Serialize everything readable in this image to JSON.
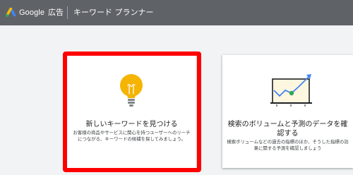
{
  "header": {
    "brand_google": "Google",
    "brand_ads": "広告",
    "tool_title": "キーワード プランナー"
  },
  "cards": [
    {
      "title": "新しいキーワードを見つける",
      "description": "お客様の商品やサービスに関心を持つユーザーへのリーチにつながる、キーワードの候補を探してみましょう。",
      "icon": "lightbulb-icon",
      "highlighted": true
    },
    {
      "title": "検索のボリュームと予測のデータを確認する",
      "description": "検索ボリュームなどの過去の指標のほか、そうした指標の効果に関する予測を確認しましょう",
      "icon": "line-chart-icon",
      "highlighted": false
    }
  ],
  "colors": {
    "topbar": "#5f6368",
    "background": "#f1f3f4",
    "highlight": "#ff0000",
    "bulb": "#f4b400",
    "chart_line": "#4285f4",
    "chart_point": "#34a853"
  }
}
